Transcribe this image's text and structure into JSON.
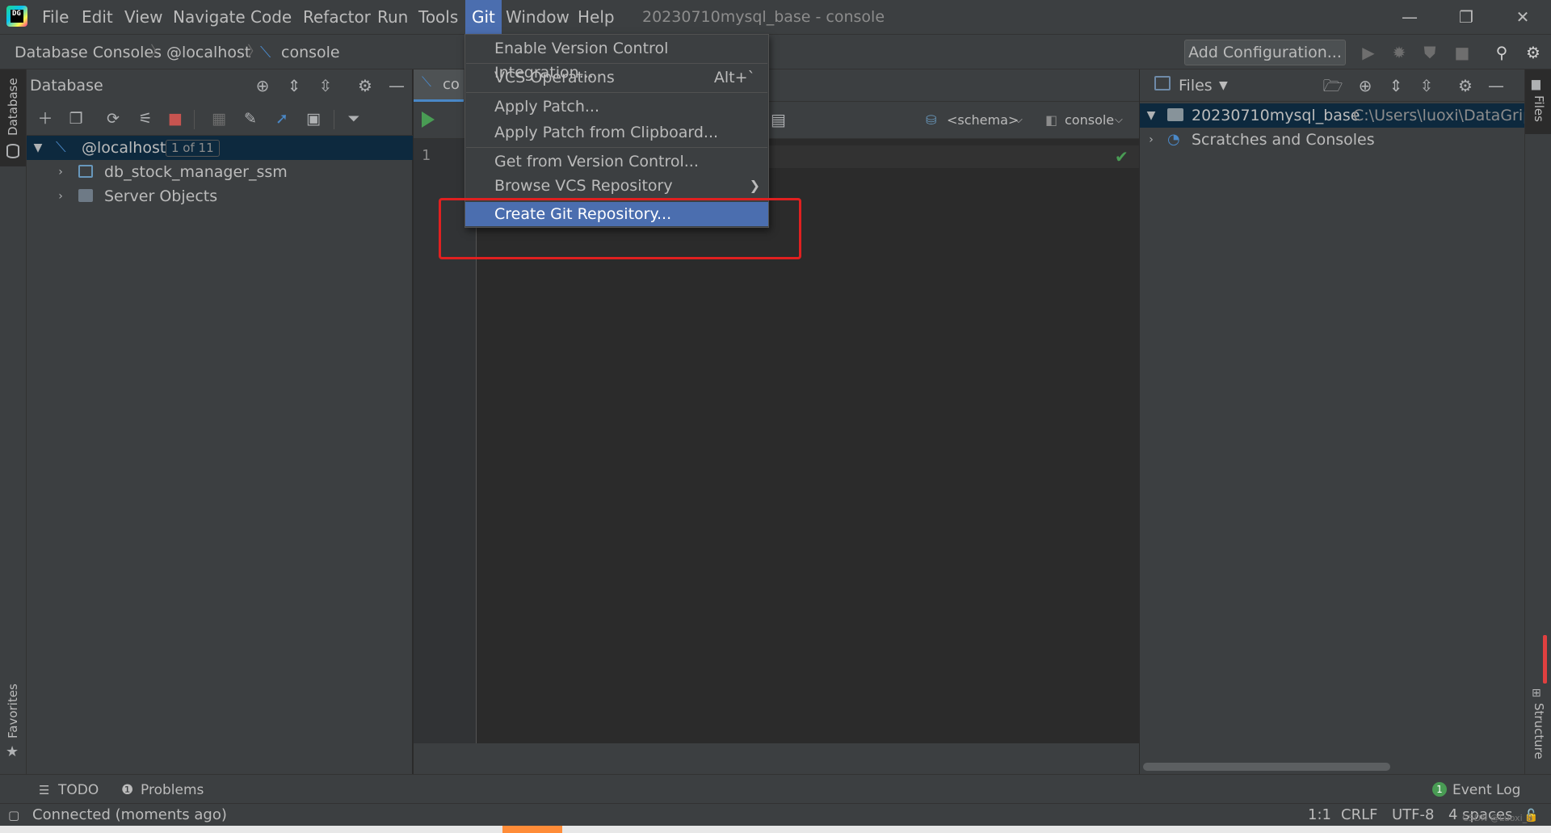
{
  "menubar": {
    "items": [
      "File",
      "Edit",
      "View",
      "Navigate",
      "Code",
      "Refactor",
      "Run",
      "Tools",
      "Git",
      "Window",
      "Help"
    ],
    "active": "Git",
    "window_title": "20230710mysql_base - console",
    "logo_text": "DG"
  },
  "window_controls": {
    "minimize": "—",
    "restore": "❐",
    "close": "✕"
  },
  "navbar": {
    "breadcrumbs": [
      "Database Consoles",
      "@localhost",
      "console"
    ],
    "add_configuration": "Add Configuration..."
  },
  "left_stripe": {
    "database_tab": "Database",
    "favorites_tab": "Favorites"
  },
  "database_panel": {
    "title": "Database",
    "tree": [
      {
        "label": "@localhost",
        "badge": "1 of 11",
        "expanded": true
      },
      {
        "label": "db_stock_manager_ssm"
      },
      {
        "label": "Server Objects"
      }
    ]
  },
  "editor": {
    "tab_label": "co",
    "schema_select": "<schema>",
    "console_select": "console",
    "line_number": "1"
  },
  "files_panel": {
    "title": "Files",
    "tree": [
      {
        "label": "20230710mysql_base",
        "path": "C:\\Users\\luoxi\\DataGripP"
      },
      {
        "label": "Scratches and Consoles"
      }
    ]
  },
  "right_stripe": {
    "files_tab": "Files",
    "structure_tab": "Structure"
  },
  "git_menu": {
    "items": [
      {
        "label": "Enable Version Control Integration..."
      },
      {
        "label": "VCS Operations",
        "shortcut": "Alt+`"
      },
      {
        "label": "Apply Patch..."
      },
      {
        "label": "Apply Patch from Clipboard..."
      },
      {
        "label": "Get from Version Control..."
      },
      {
        "label": "Browse VCS Repository"
      },
      {
        "label": "Create Git Repository..."
      }
    ],
    "highlighted": "Create Git Repository..."
  },
  "tool_windows": {
    "todo": "TODO",
    "problems": "Problems",
    "event_log_count": "1",
    "event_log": "Event Log"
  },
  "status_bar": {
    "connection": "Connected (moments ago)",
    "position": "1:1",
    "line_sep": "CRLF",
    "encoding": "UTF-8",
    "indent": "4 spaces"
  },
  "watermark": "CSDN @Luoxi_8",
  "colors": {
    "accent": "#4b6eaf",
    "highlight_box": "#e02020",
    "run": "#499c54"
  }
}
